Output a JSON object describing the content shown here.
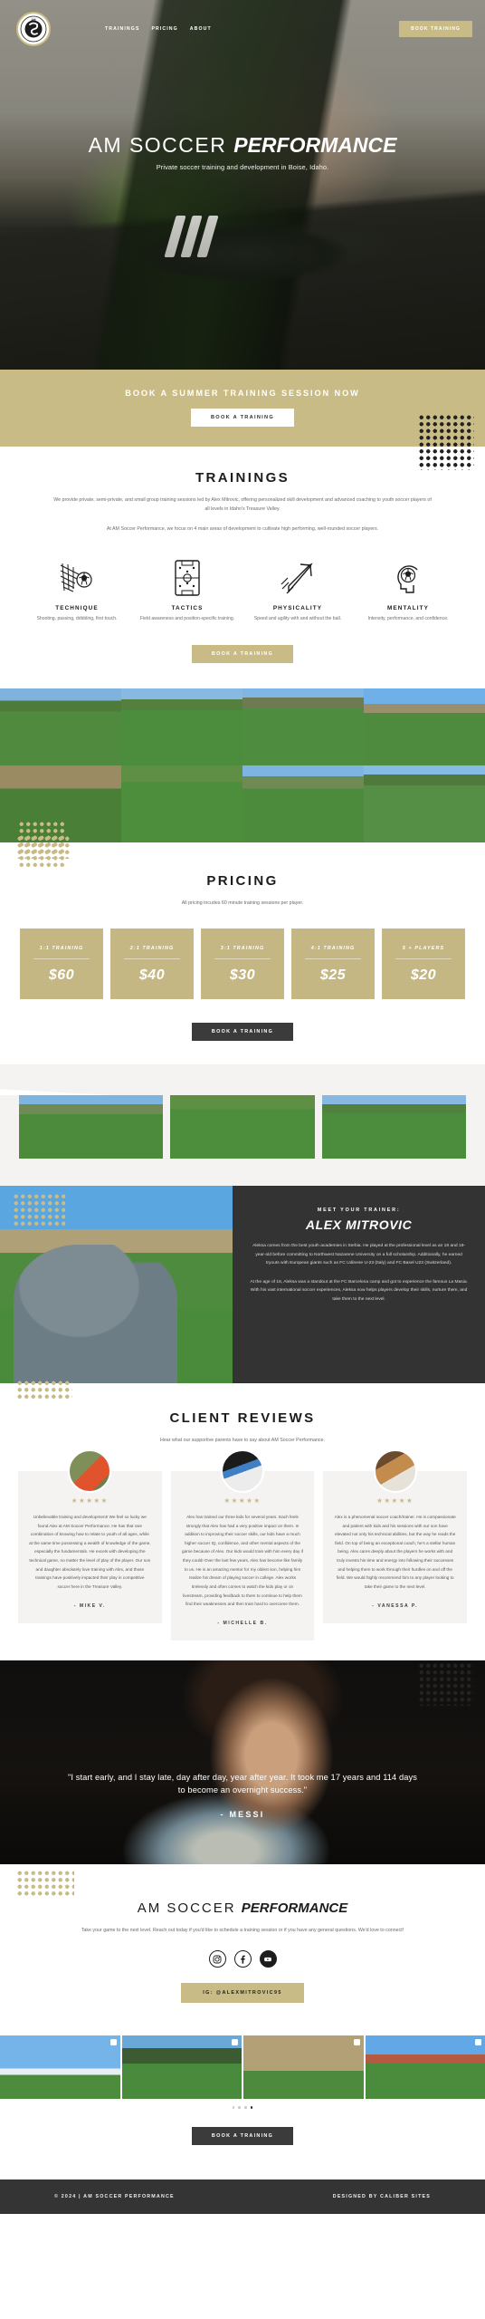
{
  "brand": {
    "logo_initials": "AM",
    "logo_ring_text": "SOCCER PERFORMANCE"
  },
  "nav": {
    "items": [
      {
        "label": "TRAININGS"
      },
      {
        "label": "PRICING"
      },
      {
        "label": "ABOUT"
      }
    ],
    "cta_label": "BOOK TRAINING"
  },
  "hero": {
    "title_regular": "AM SOCCER ",
    "title_italic": "PERFORMANCE",
    "subtitle": "Private soccer training and development in Boise, Idaho."
  },
  "cta_band": {
    "heading": "BOOK A SUMMER TRAINING SESSION NOW",
    "button_label": "BOOK A TRAINING"
  },
  "trainings": {
    "title": "TRAININGS",
    "paragraph1": "We provide private, semi-private, and small group training sessions led by Alex Mitrovic, offering personalized skill development and advanced coaching to youth soccer players of all levels in Idaho's Treasure Valley.",
    "paragraph2": "At AM Soccer Performance, we focus on 4 main areas of development to cultivate high performing, well-rounded soccer players.",
    "pillars": [
      {
        "icon": "goal-net-ball-icon",
        "title": "TECHNIQUE",
        "text": "Shooting, passing, dribbling, first touch."
      },
      {
        "icon": "tactics-pitch-icon",
        "title": "TACTICS",
        "text": "Field awareness and position-specific training."
      },
      {
        "icon": "rocket-arrow-icon",
        "title": "PHYSICALITY",
        "text": "Speed and agility with and without the ball."
      },
      {
        "icon": "head-brain-ball-icon",
        "title": "MENTALITY",
        "text": "Intensity, performance, and confidence."
      }
    ],
    "button_label": "BOOK A TRAINING"
  },
  "gallery_top": {
    "photos": [
      {
        "alt": "player striking pink ball on turf"
      },
      {
        "alt": "coach and players at training cones"
      },
      {
        "alt": "two players dribbling past cone"
      },
      {
        "alt": "group of players on field with hills"
      },
      {
        "alt": "two players training near foothills"
      },
      {
        "alt": "player shooting pink ball"
      },
      {
        "alt": "small-sided game in progress"
      },
      {
        "alt": "player in white shirt from behind"
      }
    ]
  },
  "pricing": {
    "title": "PRICING",
    "subtitle": "All pricing incudes 60 minute training sessions per player.",
    "cards": [
      {
        "label": "1:1 TRAINING",
        "price": "$60"
      },
      {
        "label": "2:1 TRAINING",
        "price": "$40"
      },
      {
        "label": "3:1 TRAINING",
        "price": "$30"
      },
      {
        "label": "4:1 TRAINING",
        "price": "$25"
      },
      {
        "label": "5 + PLAYERS",
        "price": "$20"
      }
    ],
    "button_label": "BOOK A TRAINING"
  },
  "gallery_mid": {
    "photos": [
      {
        "alt": "wide field with players training"
      },
      {
        "alt": "close up of feet and pink ball on ladder"
      },
      {
        "alt": "players running cone drill"
      }
    ]
  },
  "trainer": {
    "kicker": "MEET YOUR TRAINER:",
    "name": "ALEX MITROVIC",
    "photo_alt": "Alex Mitrovic on the field",
    "bio1": "Aleksa comes from the best youth academies in Serbia. He played at the professional level as an 18 and 19-year-old before committing to Northwest Nazarene University on a full scholarship. Additionally, he earned tryouts with European giants such as FC Udinese U-23 (Italy) and FC Basel U23 (Switzerland).",
    "bio2": "At the age of 16, Aleksa was a standout at the FC Barcelona camp and got to experience the famous La Masia. With his vast international soccer experiences, Aleksa now helps players develop their skills, nurture them, and take them to the next level."
  },
  "reviews": {
    "title": "CLIENT REVIEWS",
    "subtitle": "Hear what our supportive parents have to say about AM Soccer Performance.",
    "stars": "★★★★★",
    "items": [
      {
        "avatar_alt": "orange cleat on grass",
        "text": "Unbelievable training and development! We feel so lucky we found Alex at AM Soccer Performance. He has that rare combination of knowing how to relate to youth of all ages, while at the same time possessing a wealth of knowledge of the game, especially the fundamentals. He excels with developing the technical game, no matter the level of play of the player. Our son and daughter absolutely love training with Alex, and those trainings have positively impacted their play in competitive soccer here in the Treasure Valley.",
        "author": "- MIKE V."
      },
      {
        "avatar_alt": "foot on soccer ball",
        "text": "Alex has trained our three kids for several years. Each feels strongly that Alex has had a very positive impact on them. In addition to improving their soccer skills, our kids have a much higher soccer IQ, confidence, and other mental aspects of the game because of Alex. Our kids would train with him every day if they could! Over the last few years, Alex has become like family to us. He is an amazing mentor for my oldest son, helping him realize his dream of playing soccer in college. Alex works tirelessly and often comes to watch the kids play or on livestream, providing feedback to them to continue to help them find their weaknesses and then train hard to overcome them.",
        "author": "- MICHELLE B."
      },
      {
        "avatar_alt": "child kicking ball indoors",
        "text": "Alex is a phenomenal soccer coach/trainer. He is compassionate and patient with kids and his sessions with our son have elevated not only his technical abilities, but the way he reads the field. On top of being an exceptional coach, he's a stellar human being. Alex cares deeply about the players he works with and truly invests his time and energy into following their successes and helping them to work through their hurdles on and off the field. We would highly recommend him to any player looking to take their game to the next level.",
        "author": "- VANESSA P."
      }
    ]
  },
  "quote": {
    "text": "\"I start early, and I stay late, day after day, year after year. It took me 17 years and 114 days to become an overnight success.\"",
    "attribution": "- MESSI",
    "photo_alt": "Messi portrait"
  },
  "contact": {
    "title_regular": "AM SOCCER ",
    "title_italic": "PERFORMANCE",
    "paragraph": "Take your game to the next level. Reach out today if you'd like to schedule a training session or if you have any general questions. We'd love to connect!",
    "socials": [
      {
        "icon": "instagram-icon",
        "name": "Instagram"
      },
      {
        "icon": "facebook-icon",
        "name": "Facebook"
      },
      {
        "icon": "youtube-icon",
        "name": "YouTube"
      }
    ],
    "ig_button_label": "IG: @ALEXMITROVIC95"
  },
  "ig_feed": {
    "photos": [
      {
        "alt": "sky and field clip"
      },
      {
        "alt": "player with ponytail running"
      },
      {
        "alt": "hillside and field"
      },
      {
        "alt": "team in blue kits"
      }
    ],
    "dot_count": 4,
    "active_dot": 4
  },
  "final_cta": {
    "button_label": "BOOK A TRAINING"
  },
  "footer": {
    "copyright": "© 2024 | AM SOCCER PERFORMANCE",
    "credit": "DESIGNED BY CALIBER SITES"
  },
  "colors": {
    "gold": "#c9bb85",
    "dark": "#343434",
    "light_gray": "#f4f3f1"
  }
}
